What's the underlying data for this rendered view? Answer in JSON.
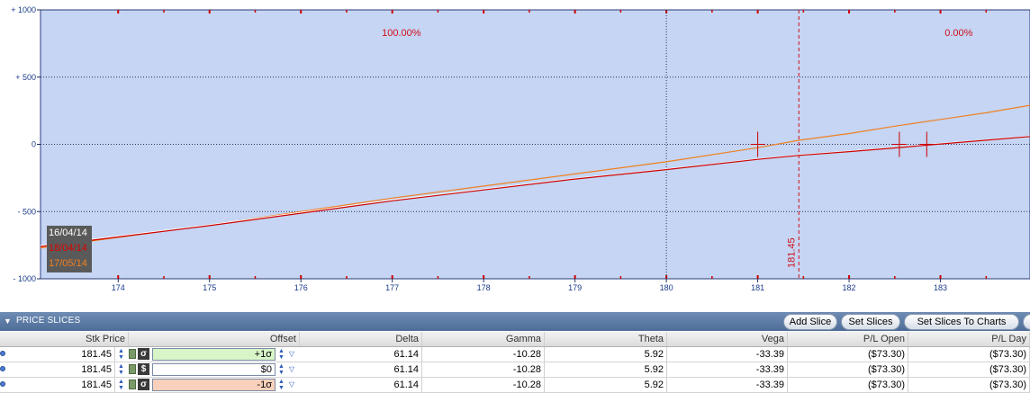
{
  "chart_data": {
    "type": "line",
    "x_ticks": [
      "174",
      "175",
      "176",
      "177",
      "178",
      "179",
      "180",
      "181",
      "182",
      "183"
    ],
    "y_ticks": [
      "+ 1000",
      "+ 500",
      "0",
      "- 500",
      "- 1000"
    ],
    "xlim": [
      173.15,
      183.98
    ],
    "ylim": [
      -1000,
      1000
    ],
    "background": "#c5d5f3",
    "grid": true,
    "probability_labels": [
      {
        "text": "100.00%",
        "x": 177.1
      },
      {
        "text": "0.00%",
        "x": 183.2
      }
    ],
    "current_price": {
      "x": 181.45,
      "label": "181.45"
    },
    "reference_line_x": 180,
    "series": [
      {
        "name": "16/04/14",
        "color": "#ffffff",
        "x": [
          173.15,
          175,
          177,
          179,
          180,
          181,
          181.45,
          182,
          182.5,
          183,
          183.5,
          183.98
        ],
        "y": [
          -755,
          -600,
          -415,
          -255,
          -185,
          -110,
          -80,
          -52,
          -25,
          5,
          33,
          60
        ]
      },
      {
        "name": "18/04/14",
        "color": "#cc0000",
        "x": [
          173.15,
          175,
          177,
          179,
          180,
          181,
          181.45,
          182,
          182.5,
          183,
          183.5,
          183.98
        ],
        "y": [
          -760,
          -605,
          -420,
          -258,
          -188,
          -112,
          -82,
          -54,
          -27,
          3,
          31,
          58
        ]
      },
      {
        "name": "17/05/14",
        "color": "#f08020",
        "x": [
          173.15,
          175,
          177,
          179,
          180,
          181,
          181.45,
          182,
          182.5,
          183,
          183.5,
          183.98
        ],
        "y": [
          -770,
          -600,
          -400,
          -220,
          -130,
          -25,
          30,
          80,
          135,
          185,
          235,
          290
        ]
      }
    ],
    "breakeven_markers": [
      {
        "x": 181.0,
        "y": 0
      },
      {
        "x": 182.55,
        "y": 0
      },
      {
        "x": 182.85,
        "y": 0
      }
    ]
  },
  "legend": [
    "16/04/14",
    "18/04/14",
    "17/05/14"
  ],
  "legend_colors": [
    "#ffffff",
    "#dd0000",
    "#f08020"
  ],
  "price_slices": {
    "title": "PRICE SLICES",
    "buttons": [
      "Add Slice",
      "Set Slices",
      "Set Slices To Charts"
    ],
    "columns": [
      "Stk Price",
      "Offset",
      "Delta",
      "Gamma",
      "Theta",
      "Vega",
      "P/L Open",
      "P/L Day"
    ],
    "rows": [
      {
        "stk_price": "181.45",
        "type_icon": "σ",
        "offset": "+1σ",
        "offset_color": "#d8f5c8",
        "delta": "61.14",
        "gamma": "-10.28",
        "theta": "5.92",
        "vega": "-33.39",
        "pl_open": "($73.30)",
        "pl_day": "($73.30)"
      },
      {
        "stk_price": "181.45",
        "type_icon": "$",
        "offset": "$0",
        "offset_color": "#ffffff",
        "delta": "61.14",
        "gamma": "-10.28",
        "theta": "5.92",
        "vega": "-33.39",
        "pl_open": "($73.30)",
        "pl_day": "($73.30)"
      },
      {
        "stk_price": "181.45",
        "type_icon": "σ",
        "offset": "-1σ",
        "offset_color": "#f8d0bc",
        "delta": "61.14",
        "gamma": "-10.28",
        "theta": "5.92",
        "vega": "-33.39",
        "pl_open": "($73.30)",
        "pl_day": "($73.30)"
      }
    ]
  },
  "icons": {
    "row_marker": "row-dot-icon",
    "lock": "lock-icon",
    "spinner": "spinner-arrows-icon",
    "dropdown": "dropdown-arrow-icon"
  }
}
